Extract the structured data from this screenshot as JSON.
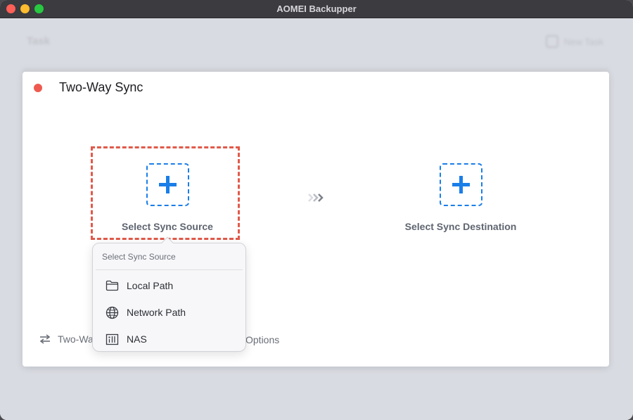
{
  "window": {
    "title": "AOMEI Backupper"
  },
  "background": {
    "page_title": "Task",
    "new_task_label": "New Task"
  },
  "dialog": {
    "title": "Two-Way Sync",
    "source_label": "Select Sync Source",
    "destination_label": "Select Sync Destination",
    "bottom_left_text": "Two-Wa",
    "bottom_options_text": "Options"
  },
  "popup": {
    "header": "Select Sync Source",
    "items": [
      {
        "label": "Local Path",
        "icon": "folder-icon"
      },
      {
        "label": "Network Path",
        "icon": "globe-icon"
      },
      {
        "label": "NAS",
        "icon": "nas-icon"
      }
    ]
  },
  "colors": {
    "accent": "#1a7ee8",
    "highlight": "#e05a4a",
    "close": "#ee5a4f"
  }
}
